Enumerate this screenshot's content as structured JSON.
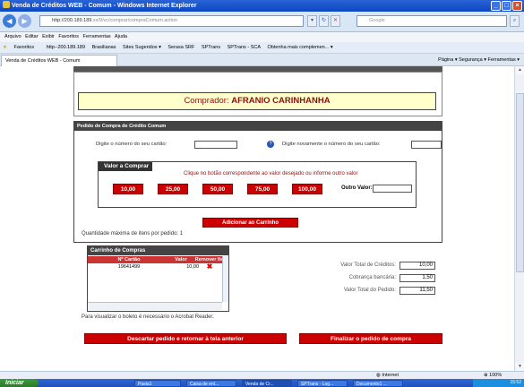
{
  "window": {
    "title": "Venda de Créditos WEB - Comum - Windows Internet Explorer",
    "buttons": [
      "_",
      "□",
      "×"
    ]
  },
  "address": {
    "url_host": "http://200.189.189.",
    "url_rest": "xx/9/vc/comprar/compraComum.action",
    "search_placeholder": "Google"
  },
  "menu": {
    "items": "Arquivo  Editar  Exibir  Favoritos  Ferramentas  Ajuda"
  },
  "favorites": {
    "label": "Favoritos",
    "items": [
      "http--200.189.189",
      "Brasilianas",
      "Sites Sugeridos ▾",
      "Serasa SRF",
      "SPTrans",
      "SPTrans - SCA",
      "Obtenha mais complemen... ▾"
    ]
  },
  "tab": {
    "label": "Venda de Créditos WEB - Comum",
    "commands": "Página ▾  Segurança ▾  Ferramentas ▾"
  },
  "buyer": {
    "label": "Comprador:",
    "name": "AFRANIO CARINHANHA"
  },
  "order": {
    "heading": "Pedido de Compra de Crédito Comum",
    "card_label": "Digite o número do seu cartão:",
    "card_confirm_label": "Digite novamente o número do seu cartão:",
    "value_heading": "Valor a Comprar",
    "value_instruction": "Clique no botão correspondente ao valor desejado ou informe outro valor",
    "values": [
      "10,00",
      "25,00",
      "50,00",
      "75,00",
      "100,00"
    ],
    "other_label": "Outro Valor:",
    "add_button": "Adicionar ao Carrinho",
    "max_items": "Quantidade máxima de itens por pedido: 1"
  },
  "cart": {
    "heading": "Carrinho de Compras",
    "columns": [
      "Nº Cartão",
      "Valor",
      "Remover Item"
    ],
    "rows": [
      {
        "card": "19641499",
        "value": "10,00"
      }
    ]
  },
  "totals": {
    "credits_label": "Valor Total de Créditos:",
    "credits": "10,00",
    "fee_label": "Cobrança bancária:",
    "fee": "1,50",
    "total_label": "Valor Total do Pedido:",
    "total": "11,50"
  },
  "acrobat_note": "Para visualizar o boleto é necessário o Acrobat Reader.",
  "actions": {
    "discard": "Descartar pedido e retornar à tela anterior",
    "finish": "Finalizar o pedido de compra"
  },
  "status": {
    "zone": "Internet",
    "zoom": "100%"
  },
  "taskbar": {
    "start": "Iniciar",
    "tasks": [
      "Pasta1",
      "Caixa de ent...",
      "Venda de Cr...",
      "SPTrans - Log...",
      "Documento1 ..."
    ],
    "clock": "15:52"
  }
}
